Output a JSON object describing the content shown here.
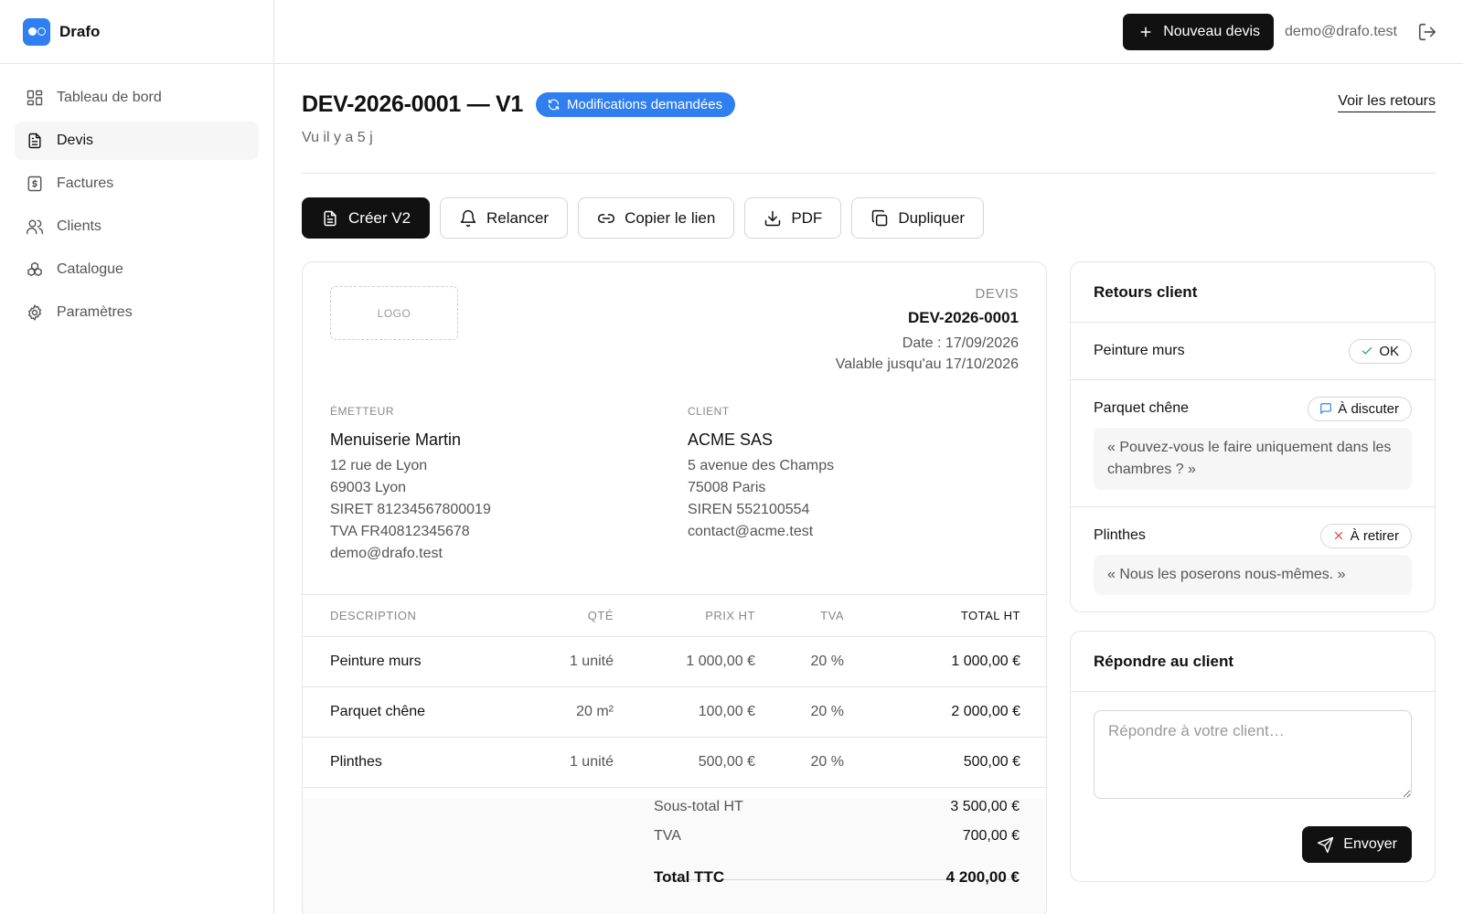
{
  "app": {
    "name": "Drafo"
  },
  "sidebar": {
    "items": [
      {
        "label": "Tableau de bord",
        "icon": "dashboard-icon"
      },
      {
        "label": "Devis",
        "icon": "document-icon",
        "active": true
      },
      {
        "label": "Factures",
        "icon": "invoice-icon"
      },
      {
        "label": "Clients",
        "icon": "users-icon"
      },
      {
        "label": "Catalogue",
        "icon": "catalog-icon"
      },
      {
        "label": "Paramètres",
        "icon": "gear-icon"
      }
    ]
  },
  "header": {
    "new_quote_label": "Nouveau devis",
    "user_email": "demo@drafo.test"
  },
  "page": {
    "title": "DEV-2026-0001 — V1",
    "status": "Modifications demandées",
    "status_color": "#2f7ff0",
    "seen": "Vu il y a 5 j",
    "view_feedback_link": "Voir les retours"
  },
  "actions": {
    "create_v2": "Créer V2",
    "remind": "Relancer",
    "copy_link": "Copier le lien",
    "pdf": "PDF",
    "duplicate": "Dupliquer"
  },
  "quote": {
    "logo_placeholder": "LOGO",
    "kind": "DEVIS",
    "number": "DEV-2026-0001",
    "date": "Date : 17/09/2026",
    "valid_until": "Valable jusqu'au 17/10/2026",
    "issuer": {
      "label": "ÉMETTEUR",
      "name": "Menuiserie Martin",
      "lines": [
        "12 rue de Lyon",
        "69003 Lyon",
        "SIRET 81234567800019",
        "TVA FR40812345678",
        "demo@drafo.test"
      ]
    },
    "client": {
      "label": "CLIENT",
      "name": "ACME SAS",
      "lines": [
        "5 avenue des Champs",
        "75008 Paris",
        "SIREN 552100554",
        "contact@acme.test"
      ]
    },
    "columns": {
      "desc": "DESCRIPTION",
      "qty": "QTÉ",
      "price": "PRIX HT",
      "tva": "TVA",
      "total": "TOTAL HT"
    },
    "rows": [
      {
        "desc": "Peinture murs",
        "qty": "1 unité",
        "price": "1 000,00 €",
        "tva": "20 %",
        "total": "1 000,00 €"
      },
      {
        "desc": "Parquet chêne",
        "qty": "20 m²",
        "price": "100,00 €",
        "tva": "20 %",
        "total": "2 000,00 €"
      },
      {
        "desc": "Plinthes",
        "qty": "1 unité",
        "price": "500,00 €",
        "tva": "20 %",
        "total": "500,00 €"
      }
    ],
    "totals": {
      "subtotal_label": "Sous-total HT",
      "subtotal": "3 500,00 €",
      "tva_label": "TVA",
      "tva": "700,00 €",
      "total_label": "Total TTC",
      "total": "4 200,00 €"
    }
  },
  "feedback": {
    "title": "Retours client",
    "items": [
      {
        "item": "Peinture murs",
        "status": "OK",
        "status_icon": "check-icon",
        "status_color": "#1a9d5b",
        "comment": null
      },
      {
        "item": "Parquet chêne",
        "status": "À discuter",
        "status_icon": "message-icon",
        "status_color": "#2f7ff0",
        "comment": "« Pouvez-vous le faire uniquement dans les chambres ? »"
      },
      {
        "item": "Plinthes",
        "status": "À retirer",
        "status_icon": "x-icon",
        "status_color": "#e0363a",
        "comment": "« Nous les poserons nous-mêmes. »"
      }
    ]
  },
  "reply": {
    "title": "Répondre au client",
    "placeholder": "Répondre à votre client…",
    "send_label": "Envoyer"
  }
}
